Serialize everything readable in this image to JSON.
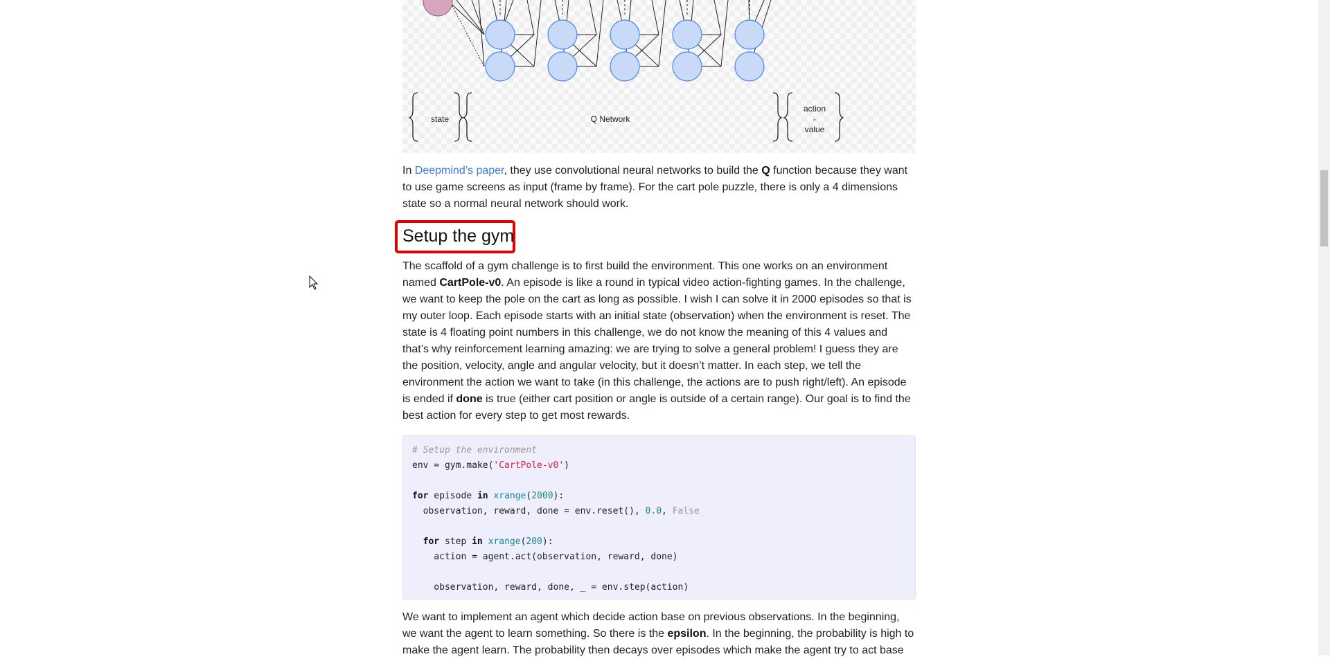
{
  "figure": {
    "state_label": "state",
    "network_label": "Q Network",
    "action_label_line1": "action",
    "action_label_line2": "-",
    "action_label_line3": "value"
  },
  "paragraph1": {
    "prefix": "In ",
    "link_text": "Deepmind’s paper",
    "mid": ", they use convolutional neural networks to build the ",
    "bold_q": "Q",
    "suffix": " function because they want to use game screens as input (frame by frame). For the cart pole puzzle, there is only a 4 dimensions state so a normal neural network should work."
  },
  "heading": "Setup the gym",
  "paragraph2": {
    "part1": "The scaffold of a gym challenge is to first build the environment. This one works on an environment named ",
    "bold_env": "CartPole-v0",
    "part2": ". An episode is like a round in typical video action-fighting games. In the challenge, we want to keep the pole on the cart as long as possible. I wish I can solve it in 2000 episodes so that is my outer loop. Each episode starts with an initial state (observation) when the environment is reset. The state is 4 floating point numbers in this challenge, we do not know the meaning of this 4 values and that’s why reinforcement learning amazing: we are trying to solve a general problem! I guess they are the position, velocity, angle and angular velocity, but it doesn’t matter. In each step, we tell the environment the action we want to take (in this challenge, the actions are to push right/left). An episode is ended if ",
    "bold_done": "done",
    "part3": " is true (either cart position or angle is outside of a certain range). Our goal is to find the best action for every step to get most rewards."
  },
  "code": {
    "comment": "# Setup the environment",
    "l2_a": "env = gym.make(",
    "l2_str": "'CartPole-v0'",
    "l2_b": ")",
    "l4_kw1": "for",
    "l4_a": " episode ",
    "l4_kw2": "in",
    "l4_fn": "xrange",
    "l4_num": "2000",
    "l4_b": "):",
    "l5_a": "  observation, reward, done = env.reset(), ",
    "l5_num": "0.0",
    "l5_sep": ", ",
    "l5_bool": "False",
    "l7_kw1": "for",
    "l7_a": " step ",
    "l7_kw2": "in",
    "l7_fn": "xrange",
    "l7_num": "200",
    "l7_b": "):",
    "l8": "    action = agent.act(observation, reward, done)",
    "l10": "    observation, reward, done, _ = env.step(action)"
  },
  "paragraph3": {
    "part1": "We want to implement an agent which decide action base on previous observations. In the beginning, we want the agent to learn something. So there is the ",
    "bold_eps": "epsilon",
    "part2": ". In the beginning, the probability is high to make the agent learn. The probability then decays over episodes which make the agent try to act base"
  }
}
